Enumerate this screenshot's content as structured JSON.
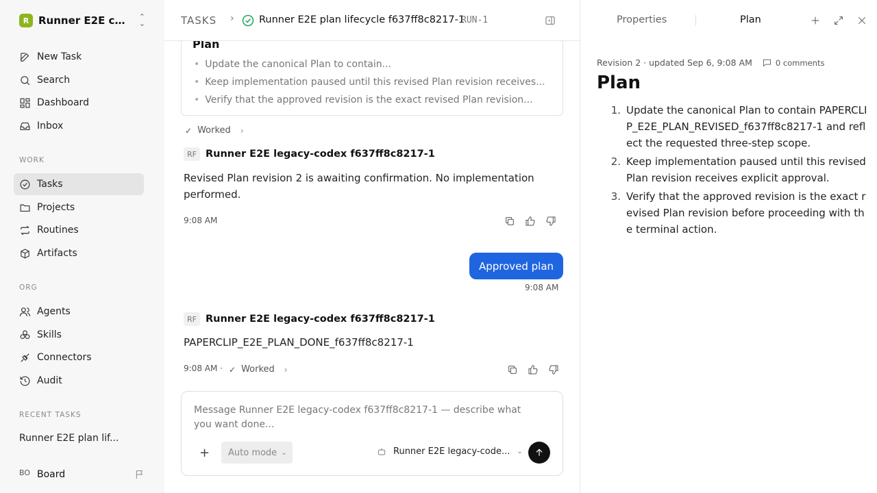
{
  "sidebar": {
    "workspace_initial": "R",
    "workspace_name": "Runner E2E co...",
    "nav": [
      {
        "label": "New Task",
        "icon": "edit-icon"
      },
      {
        "label": "Search",
        "icon": "search-icon"
      },
      {
        "label": "Dashboard",
        "icon": "dashboard-icon"
      },
      {
        "label": "Inbox",
        "icon": "inbox-icon"
      }
    ],
    "work_label": "WORK",
    "work": [
      {
        "label": "Tasks",
        "icon": "check-circle-icon",
        "active": true
      },
      {
        "label": "Projects",
        "icon": "folder-icon"
      },
      {
        "label": "Routines",
        "icon": "repeat-icon"
      },
      {
        "label": "Artifacts",
        "icon": "box-icon"
      }
    ],
    "org_label": "ORG",
    "org": [
      {
        "label": "Agents",
        "icon": "users-icon"
      },
      {
        "label": "Skills",
        "icon": "skills-icon"
      },
      {
        "label": "Connectors",
        "icon": "plug-icon"
      },
      {
        "label": "Audit",
        "icon": "history-icon"
      }
    ],
    "recent_label": "RECENT TASKS",
    "recent_task": "Runner E2E plan lif...",
    "user_initials": "BO",
    "user_name": "Board"
  },
  "header": {
    "breadcrumb": "TASKS",
    "task_title": "Runner E2E plan lifecycle f637ff8c8217-1",
    "run_id": "RUN-1"
  },
  "plan_card": {
    "title": "Plan",
    "items": [
      "Update the canonical Plan to contain...",
      "Keep implementation paused until this revised Plan revision receives...",
      "Verify that the approved revision is the exact revised Plan revision..."
    ]
  },
  "thread": {
    "worked_label": "Worked",
    "agent_initials": "RF",
    "agent_name": "Runner E2E legacy-codex f637ff8c8217-1",
    "msg1": "Revised Plan revision 2 is awaiting confirmation. No implementation performed.",
    "msg1_time": "9:08 AM",
    "user_msg": "Approved plan",
    "user_msg_time": "9:08 AM",
    "msg2": "PAPERCLIP_E2E_PLAN_DONE_f637ff8c8217-1",
    "msg2_time": "9:08 AM",
    "dot": "·"
  },
  "composer": {
    "placeholder": "Message Runner E2E legacy-codex f637ff8c8217-1 — describe what you want done...",
    "mode": "Auto mode",
    "agent": "Runner E2E legacy-code..."
  },
  "right_panel": {
    "tabs": [
      "Properties",
      "Plan"
    ],
    "active_tab": "Plan",
    "revision": "Revision 2 · updated Sep 6, 9:08 AM",
    "comments": "0 comments",
    "title": "Plan",
    "items": [
      {
        "num": "1.",
        "text": "Update the canonical Plan to contain PAPERCLIP_E2E_PLAN_REVISED_f637ff8c8217-1 and reflect the requested three-step scope."
      },
      {
        "num": "2.",
        "text": "Keep implementation paused until this revised Plan revision receives explicit approval."
      },
      {
        "num": "3.",
        "text": "Verify that the approved revision is the exact revised Plan revision before proceeding with the terminal action."
      }
    ]
  },
  "colors": {
    "accent": "#2065e0",
    "success": "#1fa55a",
    "workspace_logo": "#8db51d"
  }
}
